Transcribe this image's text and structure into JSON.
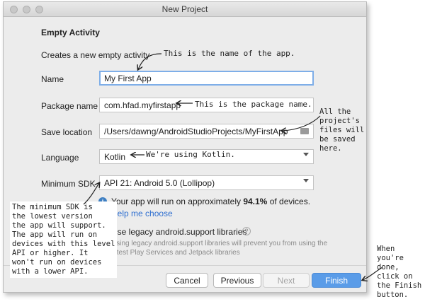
{
  "window": {
    "title": "New Project"
  },
  "page": {
    "heading": "Empty Activity",
    "description": "Creates a new empty activity"
  },
  "form": {
    "name": {
      "label": "Name",
      "value": "My First App"
    },
    "package": {
      "label": "Package name",
      "value": "com.hfad.myfirstapp"
    },
    "location": {
      "label": "Save location",
      "value": "/Users/dawng/AndroidStudioProjects/MyFirstApp"
    },
    "language": {
      "label": "Language",
      "value": "Kotlin"
    },
    "min_sdk": {
      "label": "Minimum SDK",
      "value": "API 21: Android 5.0 (Lollipop)"
    }
  },
  "info": {
    "pre": "Your app will run on approximately ",
    "percent": "94.1%",
    "post": " of devices.",
    "link": "Help me choose"
  },
  "legacy": {
    "label": "Use legacy android.support libraries",
    "hint": "Using legacy android.support libraries will prevent you from using the latest Play Services and Jetpack libraries"
  },
  "buttons": {
    "cancel": "Cancel",
    "previous": "Previous",
    "next": "Next",
    "finish": "Finish"
  },
  "annotations": {
    "name_note": "This is the name of the app.",
    "package_note": "This is the package name.",
    "kotlin_note": "We're using Kotlin.",
    "files_note": [
      "All the",
      "project's",
      "files will",
      "be saved",
      "here."
    ],
    "sdk_note": [
      "The minimum SDK is",
      "the lowest version",
      "the app will support.",
      "The app will run on",
      "devices with this level",
      "API or higher. It",
      "won't run on devices",
      "with a lower API."
    ],
    "finish_note": [
      "When",
      "you're done,",
      "click on",
      "the Finish",
      "button."
    ]
  },
  "colors": {
    "accent": "#5a9ce8",
    "link": "#2f6fd0",
    "focus": "#7eaee8"
  }
}
